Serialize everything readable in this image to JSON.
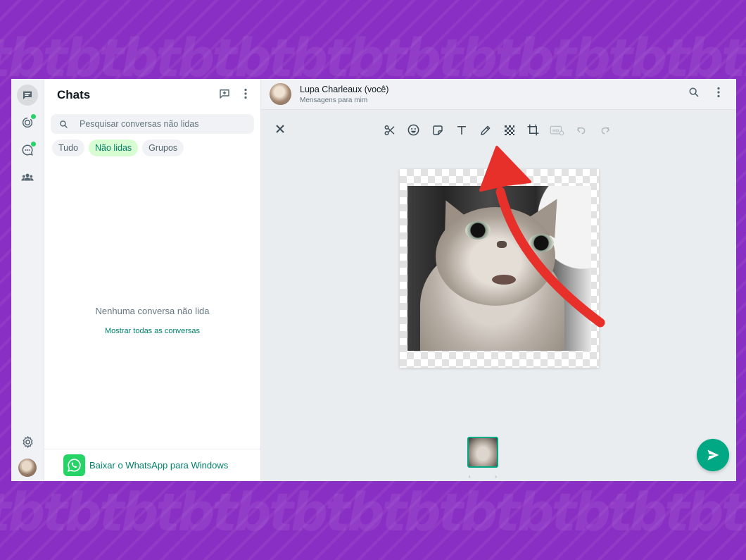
{
  "colors": {
    "accent": "#00a884",
    "link": "#008069",
    "arrow": "#e8302a",
    "background": "#8a2fc3"
  },
  "chatlist": {
    "title": "Chats",
    "search_placeholder": "Pesquisar conversas não lidas",
    "chips": [
      "Tudo",
      "Não lidas",
      "Grupos"
    ],
    "active_chip": "Não lidas",
    "empty_text": "Nenhuma conversa não lida",
    "empty_link": "Mostrar todas as conversas",
    "download_text": "Baixar o WhatsApp para Windows"
  },
  "header": {
    "contact_name": "Lupa Charleaux (você)",
    "contact_sub": "Mensagens para mim"
  },
  "icons": {
    "rail": [
      "chats-icon",
      "status-icon",
      "channels-icon",
      "communities-icon",
      "settings-icon"
    ],
    "tools": [
      "scissors-icon",
      "emoji-icon",
      "sticker-icon",
      "text-icon",
      "pencil-icon",
      "blur-icon",
      "crop-icon",
      "hd-icon",
      "undo-icon",
      "redo-icon"
    ]
  }
}
